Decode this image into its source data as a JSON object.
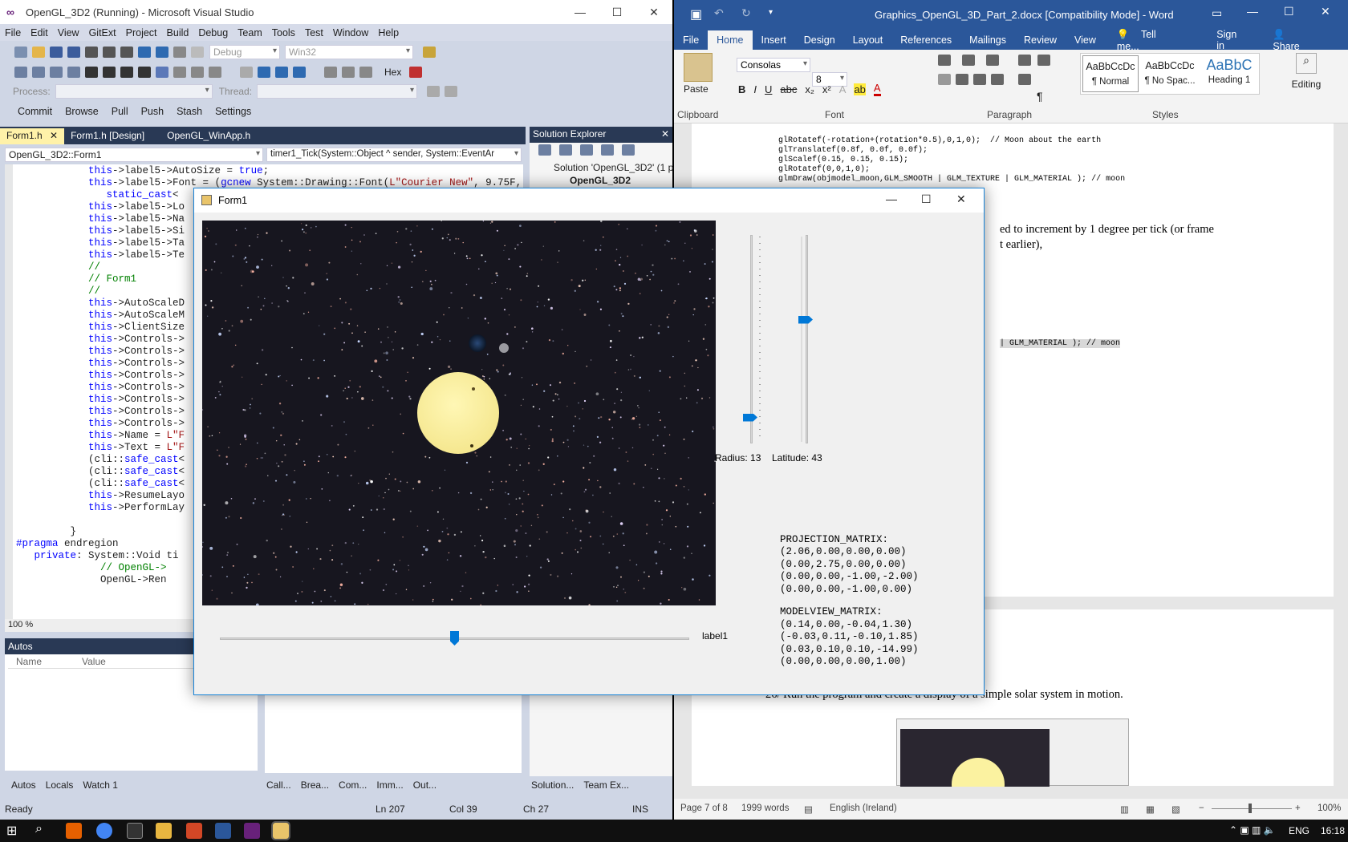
{
  "vs": {
    "title": "OpenGL_3D2 (Running) - Microsoft Visual Studio",
    "menu": [
      "File",
      "Edit",
      "View",
      "GitExt",
      "Project",
      "Build",
      "Debug",
      "Team",
      "Tools",
      "Test",
      "Window",
      "Help"
    ],
    "toolbar": {
      "config": "Debug",
      "platform": "Win32",
      "hex_label": "Hex",
      "process_label": "Process:",
      "thread_label": "Thread:"
    },
    "git_toolbar": [
      "Commit",
      "Browse",
      "Pull",
      "Push",
      "Stash",
      "Settings"
    ],
    "tabs": [
      "Form1.h",
      "Form1.h [Design]",
      "OpenGL_WinApp.h"
    ],
    "nav": {
      "scope": "OpenGL_3D2::Form1",
      "member": "timer1_Tick(System::Object ^ sender, System::EventAr"
    },
    "code_lines": [
      "            this->label5->AutoSize = true;",
      "            this->label5->Font = (gcnew System::Drawing::Font(L\"Courier New\", 9.75F,",
      "               static_cast<",
      "            this->label5->Lo",
      "            this->label5->Na",
      "            this->label5->Si",
      "            this->label5->Ta",
      "            this->label5->Te",
      "            //",
      "            // Form1",
      "            //",
      "            this->AutoScaleD",
      "            this->AutoScaleM",
      "            this->ClientSize",
      "            this->Controls->",
      "            this->Controls->",
      "            this->Controls->",
      "            this->Controls->",
      "            this->Controls->",
      "            this->Controls->",
      "            this->Controls->",
      "            this->Controls->",
      "            this->Name = L\"F",
      "            this->Text = L\"F",
      "            (cli::safe_cast<",
      "            (cli::safe_cast<",
      "            (cli::safe_cast<",
      "            this->ResumeLayo",
      "            this->PerformLay",
      "",
      "         }",
      "#pragma endregion",
      "   private: System::Void ti",
      "              // OpenGL->",
      "              OpenGL->Ren"
    ],
    "zoom": "100 %",
    "solution_explorer": {
      "title": "Solution Explorer",
      "root": "Solution 'OpenGL_3D2' (1 p",
      "project": "OpenGL_3D2"
    },
    "autos": {
      "title": "Autos",
      "col_name": "Name",
      "col_value": "Value"
    },
    "bottom_tabs_left": [
      "Autos",
      "Locals",
      "Watch 1"
    ],
    "bottom_tabs_mid": [
      "Call...",
      "Brea...",
      "Com...",
      "Imm...",
      "Out..."
    ],
    "bottom_tabs_right": [
      "Solution...",
      "Team Ex..."
    ],
    "status": {
      "state": "Ready",
      "ln": "Ln 207",
      "col": "Col 39",
      "ch": "Ch 27",
      "mode": "INS"
    }
  },
  "word": {
    "title": "Graphics_OpenGL_3D_Part_2.docx [Compatibility Mode] - Word",
    "tabs": [
      "File",
      "Home",
      "Insert",
      "Design",
      "Layout",
      "References",
      "Mailings",
      "Review",
      "View"
    ],
    "tell_me": "Tell me...",
    "sign_in": "Sign in",
    "share": "Share",
    "ribbon": {
      "paste": "Paste",
      "font": "Consolas",
      "size": "8",
      "styles": [
        {
          "preview": "AaBbCcDc",
          "name": "¶ Normal"
        },
        {
          "preview": "AaBbCcDc",
          "name": "¶ No Spac..."
        },
        {
          "preview": "AaBbC",
          "name": "Heading 1"
        }
      ],
      "editing": "Editing",
      "groups": [
        "Clipboard",
        "Font",
        "Paragraph",
        "Styles"
      ]
    },
    "doc_code": [
      "glRotatef(-rotation+(rotation*0.5),0,1,0);  // Moon about the earth",
      "glTranslatef(0.8f, 0.0f, 0.0f);",
      "glScalef(0.15, 0.15, 0.15);",
      "glRotatef(0,0,1,0);",
      "glmDraw(objmodel_moon,GLM_SMOOTH | GLM_TEXTURE | GLM_MATERIAL ); // moon"
    ],
    "doc_fragment_1": "ed to increment by 1 degree per tick (or frame",
    "doc_fragment_2": "t earlier),",
    "doc_highlight": "| GLM_MATERIAL ); // moon",
    "doc_step": "26/ Run the program and create a display of a simple solar system in motion.",
    "status": {
      "page": "Page 7 of 8",
      "words": "1999 words",
      "language": "English (Ireland)",
      "zoom": "100%"
    }
  },
  "form1": {
    "title": "Form1",
    "radius_label": "Radius: 13",
    "latitude_label": "Latitude: 43",
    "hslider_label": "label1",
    "radius_slider_value": 13,
    "latitude_slider_value": 43,
    "projection_title": "PROJECTION_MATRIX:",
    "projection": [
      "(2.06,0.00,0.00,0.00)",
      "(0.00,2.75,0.00,0.00)",
      "(0.00,0.00,-1.00,-2.00)",
      "(0.00,0.00,-1.00,0.00)"
    ],
    "modelview_title": "MODELVIEW_MATRIX:",
    "modelview": [
      "(0.14,0.00,-0.04,1.30)",
      "(-0.03,0.11,-0.10,1.85)",
      "(0.03,0.10,0.10,-14.99)",
      "(0.00,0.00,0.00,1.00)"
    ]
  },
  "taskbar": {
    "language": "ENG",
    "time": "16:18"
  },
  "colors": {
    "vs_accent": "#293955",
    "word_accent": "#2b579a",
    "slider_thumb": "#0078d7",
    "sun": "#fbf2a0"
  }
}
